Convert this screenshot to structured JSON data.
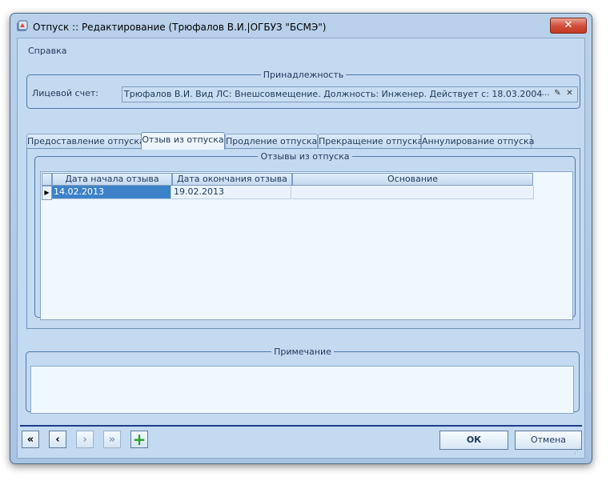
{
  "window": {
    "title": "Отпуск :: Редактирование  (Трюфалов В.И.|ОГБУЗ \"БСМЭ\")",
    "close_glyph": "✕"
  },
  "menu": {
    "items": [
      "Справка"
    ]
  },
  "ownership": {
    "legend": "Принадлежность",
    "account_label": "Лицевой счет:",
    "account_value": "Трюфалов В.И. Вид ЛС: Внешсовмещение. Должность: Инженер. Действует с: 18.03.2004",
    "buttons": [
      "…",
      "✎",
      "✕"
    ]
  },
  "tabs": [
    {
      "label": "Предоставление отпуска",
      "active": false
    },
    {
      "label": "Отзыв из отпуска",
      "active": true
    },
    {
      "label": "Продление отпуска",
      "active": false
    },
    {
      "label": "Прекращение отпуска",
      "active": false
    },
    {
      "label": "Аннулирование отпуска",
      "active": false
    }
  ],
  "recalls": {
    "legend": "Отзывы из отпуска",
    "columns": [
      "Дата начала отзыва",
      "Дата окончания отзыва",
      "Основание"
    ],
    "rows": [
      [
        "14.02.2013",
        "19.02.2013",
        ""
      ]
    ],
    "row_indicator": "▶"
  },
  "note": {
    "legend": "Примечание",
    "value": ""
  },
  "nav": {
    "first": "«",
    "prev": "‹",
    "next": "›",
    "last": "»",
    "add": "+"
  },
  "actions": {
    "ok": "ОК",
    "cancel": "Отмена"
  },
  "colors": {
    "accent": "#3d82c8",
    "add_green": "#2aa32a",
    "close_red": "#c1391f"
  }
}
